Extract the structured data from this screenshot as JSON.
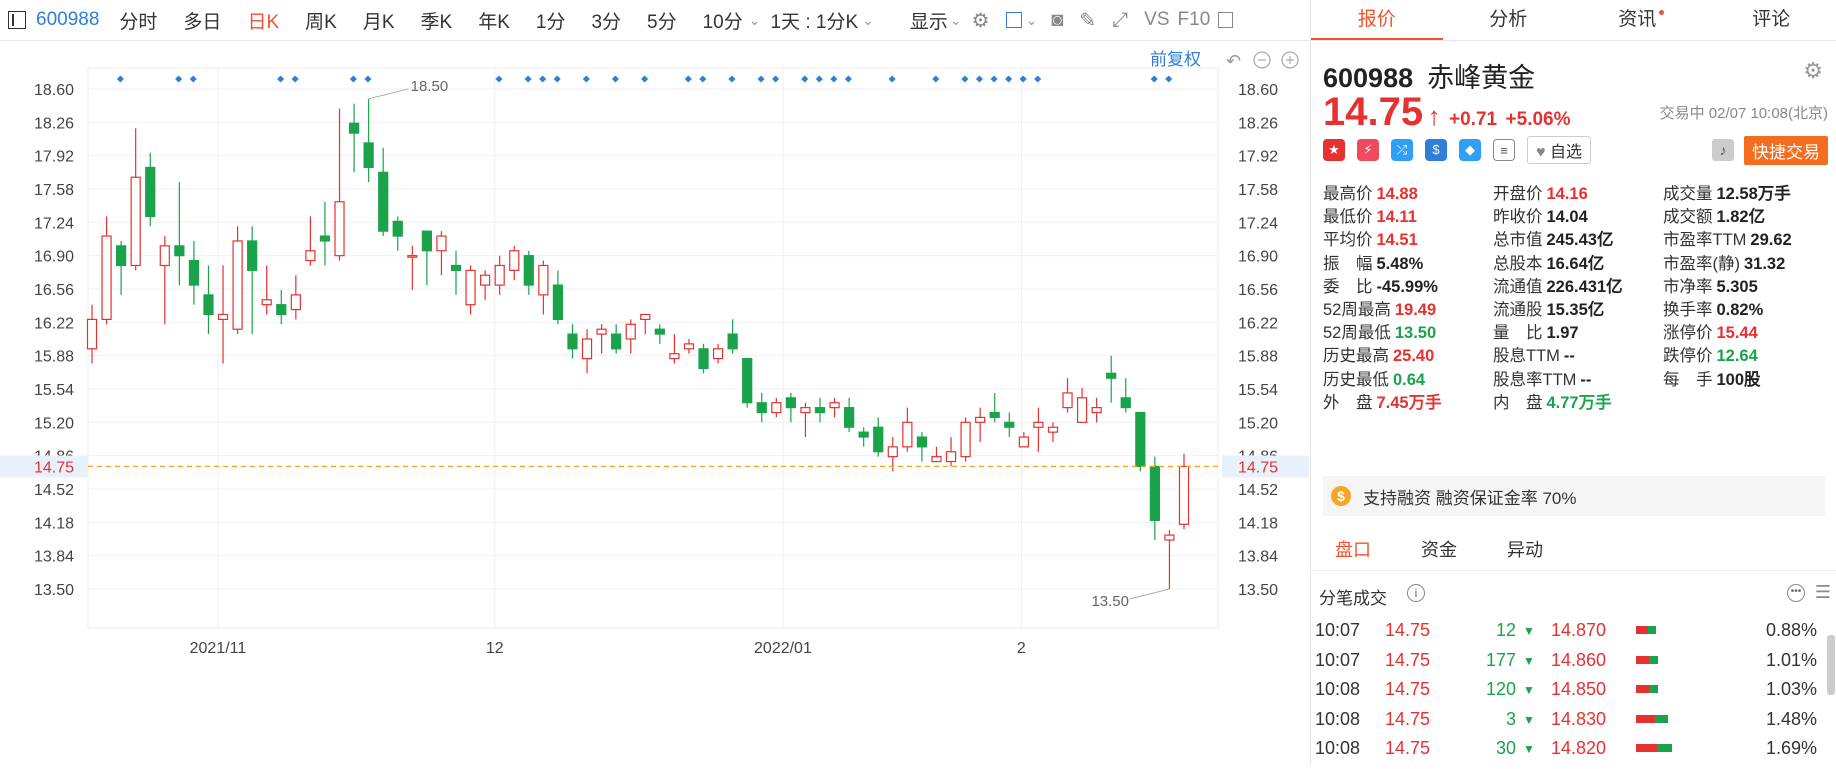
{
  "toolbar": {
    "code": "600988",
    "tabs": [
      "分时",
      "多日",
      "日K",
      "周K",
      "月K",
      "季K",
      "年K",
      "1分",
      "3分",
      "5分",
      "10分"
    ],
    "active_tab": "日K",
    "period": "1天 : 1分K",
    "display": "显示",
    "vs": "VS",
    "f10": "F10",
    "fuquan": "前复权"
  },
  "chart": {
    "price_ticks": [
      "18.60",
      "18.26",
      "17.92",
      "17.58",
      "17.24",
      "16.90",
      "16.56",
      "16.22",
      "15.88",
      "15.54",
      "15.20",
      "14.86",
      "14.52",
      "14.18",
      "13.84",
      "13.50"
    ],
    "current_price_label": "14.75",
    "current_price": 14.75,
    "max_label": "18.50",
    "min_label": "13.50",
    "date_labels": [
      "2021/11",
      "12",
      "2022/01",
      "2"
    ],
    "colors": {
      "up": "#e63131",
      "down": "#1aa34a",
      "dashed": "#f5a623",
      "marker": "#2f7fd6"
    }
  },
  "chart_data": {
    "type": "candlestick",
    "ylim": [
      13.5,
      18.6
    ],
    "candles": [
      {
        "o": 15.95,
        "c": 16.25,
        "h": 16.4,
        "l": 15.8
      },
      {
        "o": 16.25,
        "c": 17.1,
        "h": 17.3,
        "l": 16.2
      },
      {
        "o": 17.0,
        "c": 16.8,
        "h": 17.05,
        "l": 16.5
      },
      {
        "o": 16.8,
        "c": 17.7,
        "h": 18.2,
        "l": 16.75
      },
      {
        "o": 17.8,
        "c": 17.3,
        "h": 17.95,
        "l": 17.2
      },
      {
        "o": 16.8,
        "c": 17.0,
        "h": 17.1,
        "l": 16.2
      },
      {
        "o": 17.0,
        "c": 16.9,
        "h": 17.65,
        "l": 16.6
      },
      {
        "o": 16.85,
        "c": 16.6,
        "h": 17.05,
        "l": 16.4
      },
      {
        "o": 16.5,
        "c": 16.3,
        "h": 16.8,
        "l": 16.1
      },
      {
        "o": 16.25,
        "c": 16.3,
        "h": 16.8,
        "l": 15.8
      },
      {
        "o": 16.15,
        "c": 17.05,
        "h": 17.2,
        "l": 16.1
      },
      {
        "o": 17.05,
        "c": 16.75,
        "h": 17.2,
        "l": 16.1
      },
      {
        "o": 16.4,
        "c": 16.45,
        "h": 16.8,
        "l": 16.3
      },
      {
        "o": 16.4,
        "c": 16.3,
        "h": 16.55,
        "l": 16.2
      },
      {
        "o": 16.35,
        "c": 16.5,
        "h": 16.7,
        "l": 16.25
      },
      {
        "o": 16.85,
        "c": 16.95,
        "h": 17.3,
        "l": 16.8
      },
      {
        "o": 17.1,
        "c": 17.05,
        "h": 17.45,
        "l": 16.8
      },
      {
        "o": 16.9,
        "c": 17.45,
        "h": 18.4,
        "l": 16.85
      },
      {
        "o": 18.25,
        "c": 18.15,
        "h": 18.45,
        "l": 17.75
      },
      {
        "o": 18.05,
        "c": 17.8,
        "h": 18.5,
        "l": 17.65
      },
      {
        "o": 17.75,
        "c": 17.15,
        "h": 18.0,
        "l": 17.1
      },
      {
        "o": 17.25,
        "c": 17.1,
        "h": 17.3,
        "l": 16.95
      },
      {
        "o": 16.9,
        "c": 16.9,
        "h": 17.0,
        "l": 16.55
      },
      {
        "o": 17.15,
        "c": 16.95,
        "h": 17.15,
        "l": 16.6
      },
      {
        "o": 16.95,
        "c": 17.1,
        "h": 17.15,
        "l": 16.7
      },
      {
        "o": 16.8,
        "c": 16.75,
        "h": 16.95,
        "l": 16.5
      },
      {
        "o": 16.4,
        "c": 16.75,
        "h": 16.8,
        "l": 16.3
      },
      {
        "o": 16.6,
        "c": 16.7,
        "h": 16.75,
        "l": 16.45
      },
      {
        "o": 16.6,
        "c": 16.8,
        "h": 16.9,
        "l": 16.5
      },
      {
        "o": 16.75,
        "c": 16.95,
        "h": 17.0,
        "l": 16.65
      },
      {
        "o": 16.9,
        "c": 16.6,
        "h": 16.95,
        "l": 16.5
      },
      {
        "o": 16.5,
        "c": 16.8,
        "h": 16.85,
        "l": 16.3
      },
      {
        "o": 16.6,
        "c": 16.25,
        "h": 16.75,
        "l": 16.2
      },
      {
        "o": 16.1,
        "c": 15.95,
        "h": 16.2,
        "l": 15.85
      },
      {
        "o": 15.85,
        "c": 16.05,
        "h": 16.15,
        "l": 15.7
      },
      {
        "o": 16.1,
        "c": 16.15,
        "h": 16.2,
        "l": 15.9
      },
      {
        "o": 16.1,
        "c": 15.95,
        "h": 16.2,
        "l": 15.9
      },
      {
        "o": 16.05,
        "c": 16.2,
        "h": 16.25,
        "l": 15.9
      },
      {
        "o": 16.25,
        "c": 16.3,
        "h": 16.3,
        "l": 16.1
      },
      {
        "o": 16.15,
        "c": 16.1,
        "h": 16.2,
        "l": 16.0
      },
      {
        "o": 15.85,
        "c": 15.9,
        "h": 16.1,
        "l": 15.8
      },
      {
        "o": 15.95,
        "c": 16.0,
        "h": 16.05,
        "l": 15.9
      },
      {
        "o": 15.95,
        "c": 15.75,
        "h": 16.0,
        "l": 15.7
      },
      {
        "o": 15.85,
        "c": 15.95,
        "h": 16.0,
        "l": 15.8
      },
      {
        "o": 16.1,
        "c": 15.95,
        "h": 16.25,
        "l": 15.9
      },
      {
        "o": 15.85,
        "c": 15.4,
        "h": 15.85,
        "l": 15.35
      },
      {
        "o": 15.4,
        "c": 15.3,
        "h": 15.5,
        "l": 15.2
      },
      {
        "o": 15.3,
        "c": 15.4,
        "h": 15.45,
        "l": 15.25
      },
      {
        "o": 15.45,
        "c": 15.35,
        "h": 15.5,
        "l": 15.2
      },
      {
        "o": 15.3,
        "c": 15.35,
        "h": 15.4,
        "l": 15.05
      },
      {
        "o": 15.35,
        "c": 15.3,
        "h": 15.45,
        "l": 15.2
      },
      {
        "o": 15.35,
        "c": 15.4,
        "h": 15.45,
        "l": 15.25
      },
      {
        "o": 15.35,
        "c": 15.15,
        "h": 15.45,
        "l": 15.1
      },
      {
        "o": 15.1,
        "c": 15.05,
        "h": 15.15,
        "l": 14.95
      },
      {
        "o": 15.15,
        "c": 14.9,
        "h": 15.25,
        "l": 14.85
      },
      {
        "o": 14.85,
        "c": 14.95,
        "h": 15.05,
        "l": 14.7
      },
      {
        "o": 14.95,
        "c": 15.2,
        "h": 15.35,
        "l": 14.9
      },
      {
        "o": 15.05,
        "c": 14.95,
        "h": 15.1,
        "l": 14.8
      },
      {
        "o": 14.8,
        "c": 14.85,
        "h": 14.95,
        "l": 14.8
      },
      {
        "o": 14.8,
        "c": 14.9,
        "h": 15.05,
        "l": 14.75
      },
      {
        "o": 14.85,
        "c": 15.2,
        "h": 15.25,
        "l": 14.8
      },
      {
        "o": 15.2,
        "c": 15.25,
        "h": 15.35,
        "l": 15.0
      },
      {
        "o": 15.3,
        "c": 15.25,
        "h": 15.5,
        "l": 15.2
      },
      {
        "o": 15.2,
        "c": 15.15,
        "h": 15.3,
        "l": 15.05
      },
      {
        "o": 14.95,
        "c": 15.05,
        "h": 15.1,
        "l": 14.95
      },
      {
        "o": 15.15,
        "c": 15.2,
        "h": 15.35,
        "l": 14.9
      },
      {
        "o": 15.1,
        "c": 15.15,
        "h": 15.2,
        "l": 15.0
      },
      {
        "o": 15.35,
        "c": 15.5,
        "h": 15.65,
        "l": 15.3
      },
      {
        "o": 15.2,
        "c": 15.45,
        "h": 15.55,
        "l": 15.2
      },
      {
        "o": 15.3,
        "c": 15.35,
        "h": 15.45,
        "l": 15.2
      },
      {
        "o": 15.7,
        "c": 15.65,
        "h": 15.88,
        "l": 15.4
      },
      {
        "o": 15.45,
        "c": 15.35,
        "h": 15.65,
        "l": 15.3
      },
      {
        "o": 15.3,
        "c": 14.75,
        "h": 15.3,
        "l": 14.7
      },
      {
        "o": 14.75,
        "c": 14.2,
        "h": 14.85,
        "l": 14.0
      },
      {
        "o": 14.0,
        "c": 14.05,
        "h": 14.1,
        "l": 13.5
      },
      {
        "o": 14.16,
        "c": 14.75,
        "h": 14.88,
        "l": 14.11
      }
    ]
  },
  "stock": {
    "code": "600988",
    "name": "赤峰黄金",
    "price": "14.75",
    "arrow": "↑",
    "change": "+0.71",
    "change_pct": "+5.06%",
    "status_time": "交易中 02/07 10:08(北京)",
    "zixuan": "自选",
    "quick_trade": "快捷交易"
  },
  "right_tabs": [
    "报价",
    "分析",
    "资讯",
    "评论"
  ],
  "stats": [
    [
      {
        "k": "最高价",
        "v": "14.88",
        "c": "red"
      },
      {
        "k": "开盘价",
        "v": "14.16",
        "c": "red"
      },
      {
        "k": "成交量",
        "v": "12.58万手",
        "c": "dark"
      }
    ],
    [
      {
        "k": "最低价",
        "v": "14.11",
        "c": "red"
      },
      {
        "k": "昨收价",
        "v": "14.04",
        "c": "dark"
      },
      {
        "k": "成交额",
        "v": "1.82亿",
        "c": "dark"
      }
    ],
    [
      {
        "k": "平均价",
        "v": "14.51",
        "c": "red"
      },
      {
        "k": "总市值",
        "v": "245.43亿",
        "c": "dark"
      },
      {
        "k": "市盈率TTM",
        "v": "29.62",
        "c": "dark"
      }
    ],
    [
      {
        "k": "振　幅",
        "v": "5.48%",
        "c": "dark"
      },
      {
        "k": "总股本",
        "v": "16.64亿",
        "c": "dark"
      },
      {
        "k": "市盈率(静)",
        "v": "31.32",
        "c": "dark"
      }
    ],
    [
      {
        "k": "委　比",
        "v": "-45.99%",
        "c": "dark"
      },
      {
        "k": "流通值",
        "v": "226.431亿",
        "c": "dark"
      },
      {
        "k": "市净率",
        "v": "5.305",
        "c": "dark"
      }
    ],
    [
      {
        "k": "52周最高",
        "v": "19.49",
        "c": "red"
      },
      {
        "k": "流通股",
        "v": "15.35亿",
        "c": "dark"
      },
      {
        "k": "换手率",
        "v": "0.82%",
        "c": "dark"
      }
    ],
    [
      {
        "k": "52周最低",
        "v": "13.50",
        "c": "green"
      },
      {
        "k": "量　比",
        "v": "1.97",
        "c": "dark"
      },
      {
        "k": "涨停价",
        "v": "15.44",
        "c": "red"
      }
    ],
    [
      {
        "k": "历史最高",
        "v": "25.40",
        "c": "red"
      },
      {
        "k": "股息TTM",
        "v": "--",
        "c": "dark"
      },
      {
        "k": "跌停价",
        "v": "12.64",
        "c": "green"
      }
    ],
    [
      {
        "k": "历史最低",
        "v": "0.64",
        "c": "green"
      },
      {
        "k": "股息率TTM",
        "v": "--",
        "c": "dark"
      },
      {
        "k": "每　手",
        "v": "100股",
        "c": "dark"
      }
    ],
    [
      {
        "k": "外　盘",
        "v": "7.45万手",
        "c": "red"
      },
      {
        "k": "内　盘",
        "v": "4.77万手",
        "c": "green"
      },
      {
        "k": "",
        "v": "",
        "c": "dark"
      }
    ]
  ],
  "margin_info": "支持融资 融资保证金率 70%",
  "sub_tabs": [
    "盘口",
    "资金",
    "异动"
  ],
  "fenbi_title": "分笔成交",
  "ticks": [
    {
      "time": "10:07",
      "price": "14.75",
      "vol": "12",
      "p2": "14.870",
      "pct": "0.88%",
      "bar": 0.25
    },
    {
      "time": "10:07",
      "price": "14.75",
      "vol": "177",
      "p2": "14.860",
      "pct": "1.01%",
      "bar": 0.28
    },
    {
      "time": "10:08",
      "price": "14.75",
      "vol": "120",
      "p2": "14.850",
      "pct": "1.03%",
      "bar": 0.28
    },
    {
      "time": "10:08",
      "price": "14.75",
      "vol": "3",
      "p2": "14.830",
      "pct": "1.48%",
      "bar": 0.4
    },
    {
      "time": "10:08",
      "price": "14.75",
      "vol": "30",
      "p2": "14.820",
      "pct": "1.69%",
      "bar": 0.45
    }
  ]
}
